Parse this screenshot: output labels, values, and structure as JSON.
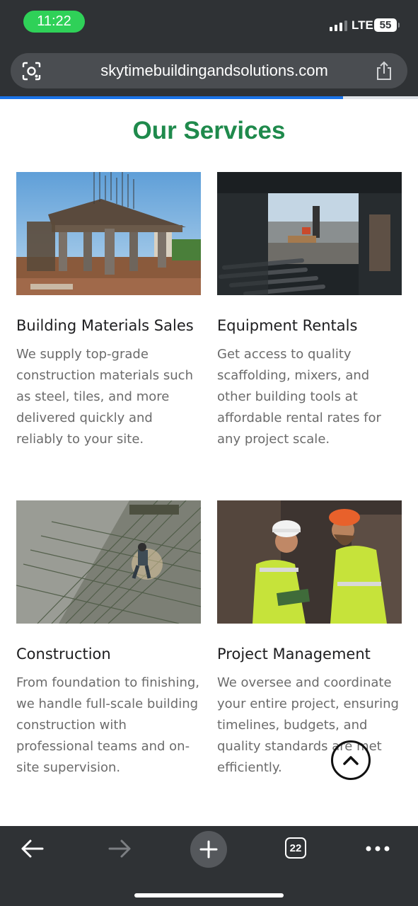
{
  "status_bar": {
    "time": "11:22",
    "network": "LTE",
    "battery": "55"
  },
  "browser": {
    "url": "skytimebuildingandsolutions.com",
    "load_progress": 0.82,
    "open_tabs_count": "22"
  },
  "page": {
    "section_title": "Our Services",
    "services": [
      {
        "title": "Building Materials Sales",
        "description": "We supply top-grade construction materials such as steel, tiles, and more delivered quickly and reliably to your site."
      },
      {
        "title": "Equipment Rentals",
        "description": "Get access to quality scaffolding, mixers, and other building tools at affordable rental rates for any project scale."
      },
      {
        "title": "Construction",
        "description": "From foundation to finishing, we handle full-scale building construction with professional teams and on-site supervision."
      },
      {
        "title": "Project Management",
        "description": "We oversee and coordinate your entire project, ensuring timelines, budgets, and quality standards are met efficiently."
      }
    ]
  },
  "colors": {
    "accent_green": "#1f8a4c",
    "progress_blue": "#1a73e8",
    "chrome_dark": "#2f3235"
  }
}
